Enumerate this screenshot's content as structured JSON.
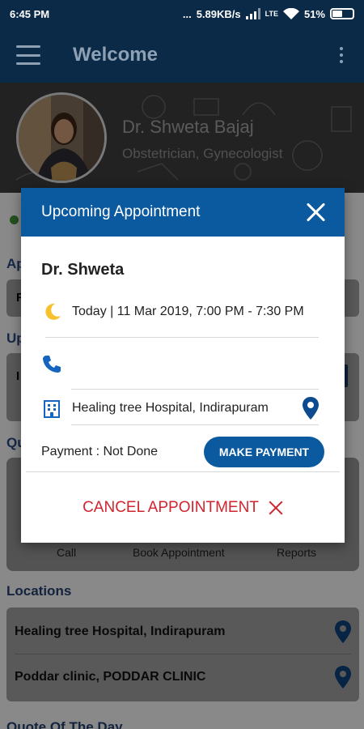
{
  "status_bar": {
    "time": "6:45 PM",
    "dots": "...",
    "network_speed": "5.89KB/s",
    "volte": "LTE",
    "battery": "51%"
  },
  "toolbar": {
    "title": "Welcome"
  },
  "doctor": {
    "name": "Dr. Shweta Bajaj",
    "specialization": "Obstetrician, Gynecologist"
  },
  "background": {
    "section_a": "Ap",
    "row_a": "F",
    "section_b": "Up",
    "row_b": "I",
    "section_c": "Qu",
    "quick_actions": [
      "Call",
      "Book Appointment",
      "Reports"
    ],
    "locations_title": "Locations",
    "locations": [
      "Healing tree Hospital, Indirapuram",
      "Poddar clinic, PODDAR CLINIC"
    ],
    "quote_title": "Quote Of The Day"
  },
  "dialog": {
    "title": "Upcoming Appointment",
    "doctor_name": "Dr. Shweta",
    "datetime": "Today | 11 Mar 2019, 7:00 PM - 7:30 PM",
    "phone": "",
    "location": "Healing tree Hospital, Indirapuram",
    "payment_status": "Payment : Not Done",
    "make_payment_label": "MAKE PAYMENT",
    "cancel_label": "CANCEL APPOINTMENT"
  },
  "colors": {
    "primary": "#0b5aa0",
    "toolbar": "#0a2a47",
    "cancel": "#d0242f",
    "icon_blue": "#1565c0",
    "moon_yellow": "#f6c12b"
  }
}
